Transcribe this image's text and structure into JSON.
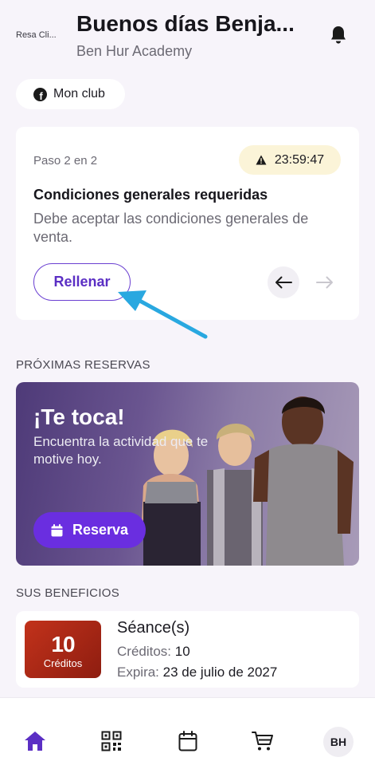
{
  "header": {
    "club_short": "Resa Cli...",
    "greeting": "Buenos días Benja...",
    "club_name": "Ben Hur Academy",
    "bell_icon": "bell-icon"
  },
  "club_chip": {
    "label": "Mon club",
    "icon": "facebook-icon"
  },
  "step_card": {
    "step": "Paso 2 en 2",
    "timer": "23:59:47",
    "timer_icon": "warning-icon",
    "title": "Condiciones generales requeridas",
    "description": "Debe aceptar las condiciones generales de venta.",
    "action_label": "Rellenar",
    "prev_icon": "arrow-left-icon",
    "next_icon": "arrow-right-icon"
  },
  "bookings": {
    "section_title": "PRÓXIMAS RESERVAS",
    "banner_title": "¡Te toca!",
    "banner_subtitle": "Encuentra la actividad que te motive hoy.",
    "book_label": "Reserva",
    "book_icon": "calendar-icon"
  },
  "benefits": {
    "section_title": "SUS BENEFICIOS",
    "thumb_number": "10",
    "thumb_word": "Créditos",
    "name": "Séance(s)",
    "credits_key": "Créditos:",
    "credits_value": "10",
    "expires_key": "Expira:",
    "expires_value": "23 de julio de 2027"
  },
  "tabbar": {
    "tabs": [
      "home-icon",
      "qr-code-icon",
      "calendar-icon",
      "cart-icon"
    ],
    "avatar_initials": "BH"
  },
  "colors": {
    "accent": "#6a2ee0",
    "outline": "#6a3fd1",
    "timer_bg": "#fbf4d8",
    "background": "#f7f4fa",
    "pointer": "#29a8e0"
  }
}
